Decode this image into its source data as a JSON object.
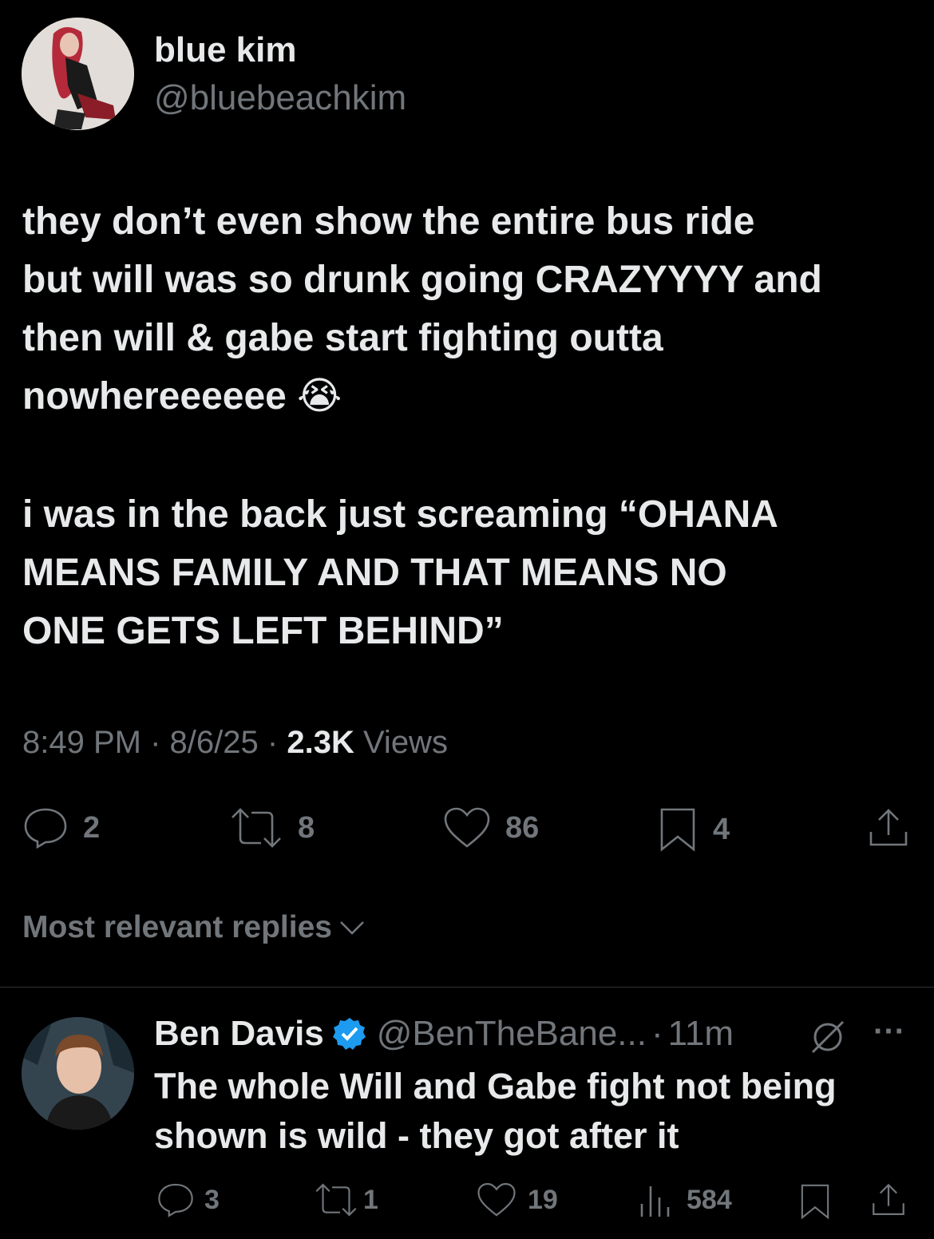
{
  "main_tweet": {
    "display_name": "blue kim",
    "handle": "@bluebeachkim",
    "text_lines": [
      "they don’t even show the entire bus ride",
      "but will was so drunk going CRAZYYYY and",
      "then will & gabe start fighting outta",
      "nowhereeeeee 😭"
    ],
    "text_lines_2": [
      "i was in the back just screaming “OHANA",
      "MEANS FAMILY AND THAT MEANS NO",
      "ONE GETS LEFT BEHIND”"
    ],
    "time": "8:49 PM",
    "separator": "·",
    "date": "8/6/25",
    "views_count": "2.3K",
    "views_label": "Views",
    "replies": "2",
    "reposts": "8",
    "likes": "86",
    "bookmarks": "4"
  },
  "sort": {
    "label": "Most relevant replies"
  },
  "reply": {
    "display_name": "Ben Davis",
    "handle": "@BenTheBane...",
    "separator": "·",
    "time": "11m",
    "more": "···",
    "text_lines": [
      "The whole Will and Gabe fight not being",
      "shown is wild - they got after it"
    ],
    "replies": "3",
    "reposts": "1",
    "likes": "19",
    "views": "584"
  },
  "colors": {
    "background": "#000000",
    "text": "#e7e9ea",
    "muted": "#71767b",
    "verified": "#1d9bf0",
    "divider": "#2f3336"
  }
}
